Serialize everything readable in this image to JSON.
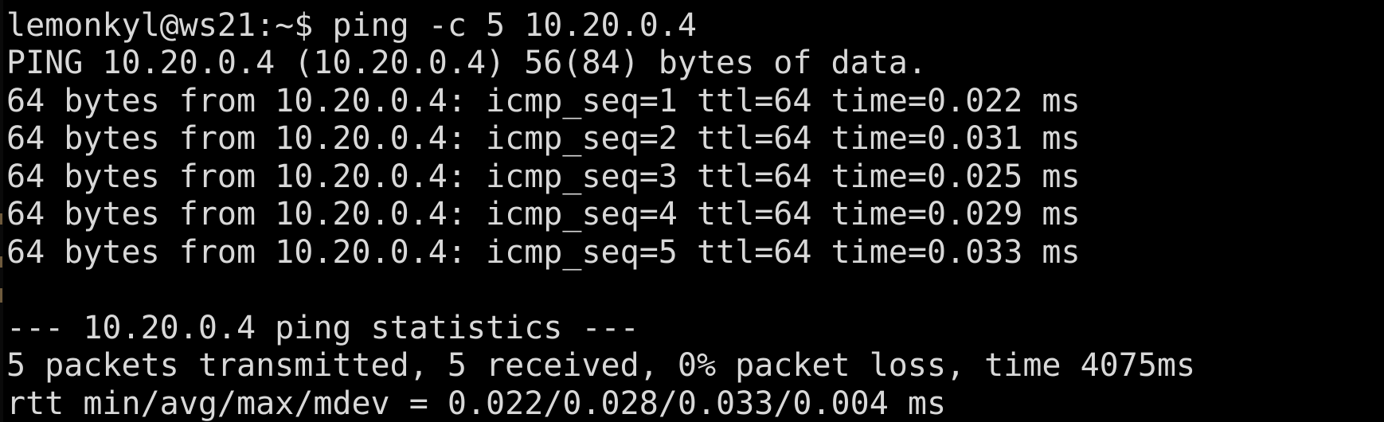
{
  "terminal": {
    "prompt": "lemonkyl@ws21:~$ ping -c 5 10.20.0.4",
    "lines": [
      "PING 10.20.0.4 (10.20.0.4) 56(84) bytes of data.",
      "64 bytes from 10.20.0.4: icmp_seq=1 ttl=64 time=0.022 ms",
      "64 bytes from 10.20.0.4: icmp_seq=2 ttl=64 time=0.031 ms",
      "64 bytes from 10.20.0.4: icmp_seq=3 ttl=64 time=0.025 ms",
      "64 bytes from 10.20.0.4: icmp_seq=4 ttl=64 time=0.029 ms",
      "64 bytes from 10.20.0.4: icmp_seq=5 ttl=64 time=0.033 ms",
      "",
      "--- 10.20.0.4 ping statistics ---",
      "5 packets transmitted, 5 received, 0% packet loss, time 4075ms",
      "rtt min/avg/max/mdev = 0.022/0.028/0.033/0.004 ms"
    ]
  },
  "colors": {
    "background": "#000000",
    "foreground": "#d8d8d8"
  }
}
